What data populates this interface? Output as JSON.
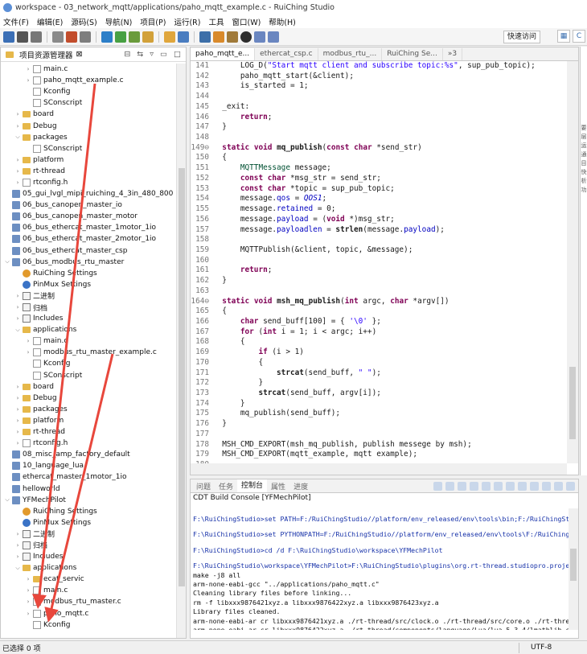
{
  "window": {
    "title": "workspace - 03_network_mqtt/applications/paho_mqtt_example.c - RuiChing Studio"
  },
  "menu": [
    "文件(F)",
    "编辑(E)",
    "源码(S)",
    "导航(N)",
    "项目(P)",
    "运行(R)",
    "工具",
    "窗口(W)",
    "帮助(H)"
  ],
  "toolbar": {
    "quick_access": "快速访问"
  },
  "explorer": {
    "title": "项目资源管理器",
    "tab_suffix": "⊠",
    "rows": [
      {
        "t": "main.c",
        "i": "file",
        "a": ">",
        "d": 2
      },
      {
        "t": "paho_mqtt_example.c",
        "i": "file",
        "a": ">",
        "d": 2
      },
      {
        "t": "Kconfig",
        "i": "file",
        "a": "",
        "d": 2
      },
      {
        "t": "SConscript",
        "i": "file",
        "a": "",
        "d": 2
      },
      {
        "t": "board",
        "i": "folder",
        "a": ">",
        "d": 1
      },
      {
        "t": "Debug",
        "i": "folder",
        "a": ">",
        "d": 1
      },
      {
        "t": "packages",
        "i": "folder",
        "a": "v",
        "d": 1
      },
      {
        "t": "SConscript",
        "i": "file",
        "a": "",
        "d": 2
      },
      {
        "t": "platform",
        "i": "folder",
        "a": ">",
        "d": 1
      },
      {
        "t": "rt-thread",
        "i": "folder",
        "a": ">",
        "d": 1
      },
      {
        "t": "rtconfig.h",
        "i": "file",
        "a": ">",
        "d": 1
      },
      {
        "t": "05_gui_lvgl_mipi_ruiching_4_3in_480_800",
        "i": "proj",
        "a": "",
        "d": 0
      },
      {
        "t": "06_bus_canopen_master_io",
        "i": "proj",
        "a": "",
        "d": 0
      },
      {
        "t": "06_bus_canopen_master_motor",
        "i": "proj",
        "a": "",
        "d": 0
      },
      {
        "t": "06_bus_ethercat_master_1motor_1io",
        "i": "proj",
        "a": "",
        "d": 0
      },
      {
        "t": "06_bus_ethercat_master_2motor_1io",
        "i": "proj",
        "a": "",
        "d": 0
      },
      {
        "t": "06_bus_ethercat_master_csp",
        "i": "proj",
        "a": "",
        "d": 0
      },
      {
        "t": "06_bus_modbus_rtu_master",
        "i": "proj",
        "a": "v",
        "d": 0
      },
      {
        "t": "RuiChing Settings",
        "i": "gear",
        "a": "",
        "d": 1
      },
      {
        "t": "PinMux Settings",
        "i": "pin",
        "a": "",
        "d": 1
      },
      {
        "t": "二进制",
        "i": "lib",
        "a": ">",
        "d": 1
      },
      {
        "t": "归档",
        "i": "lib",
        "a": ">",
        "d": 1
      },
      {
        "t": "Includes",
        "i": "lib",
        "a": ">",
        "d": 1
      },
      {
        "t": "applications",
        "i": "folder",
        "a": "v",
        "d": 1
      },
      {
        "t": "main.c",
        "i": "file",
        "a": ">",
        "d": 2
      },
      {
        "t": "modbus_rtu_master_example.c",
        "i": "file",
        "a": ">",
        "d": 2
      },
      {
        "t": "Kconfig",
        "i": "file",
        "a": "",
        "d": 2
      },
      {
        "t": "SConscript",
        "i": "file",
        "a": "",
        "d": 2
      },
      {
        "t": "board",
        "i": "folder",
        "a": ">",
        "d": 1
      },
      {
        "t": "Debug",
        "i": "folder",
        "a": ">",
        "d": 1
      },
      {
        "t": "packages",
        "i": "folder",
        "a": ">",
        "d": 1
      },
      {
        "t": "platform",
        "i": "folder",
        "a": ">",
        "d": 1
      },
      {
        "t": "rt-thread",
        "i": "folder",
        "a": ">",
        "d": 1
      },
      {
        "t": "rtconfig.h",
        "i": "file",
        "a": ">",
        "d": 1
      },
      {
        "t": "08_misc_amp_factory_default",
        "i": "proj",
        "a": "",
        "d": 0
      },
      {
        "t": "10_language_lua",
        "i": "proj",
        "a": "",
        "d": 0
      },
      {
        "t": "ethercat_master_1motor_1io",
        "i": "proj",
        "a": "",
        "d": 0
      },
      {
        "t": "helloworld",
        "i": "proj",
        "a": "",
        "d": 0
      },
      {
        "t": "YFMechPilot",
        "i": "proj",
        "a": "v",
        "d": 0
      },
      {
        "t": "RuiChing Settings",
        "i": "gear",
        "a": "",
        "d": 1
      },
      {
        "t": "PinMux Settings",
        "i": "pin",
        "a": "",
        "d": 1
      },
      {
        "t": "二进制",
        "i": "lib",
        "a": ">",
        "d": 1
      },
      {
        "t": "归档",
        "i": "lib",
        "a": ">",
        "d": 1
      },
      {
        "t": "Includes",
        "i": "lib",
        "a": ">",
        "d": 1
      },
      {
        "t": "applications",
        "i": "folder",
        "a": "v",
        "d": 1
      },
      {
        "t": "ecat_servic",
        "i": "folder",
        "a": ">",
        "d": 2
      },
      {
        "t": "main.c",
        "i": "file",
        "a": ">",
        "d": 2
      },
      {
        "t": "modbus_rtu_master.c",
        "i": "file",
        "a": ">",
        "d": 2
      },
      {
        "t": "paho_mqtt.c",
        "i": "file",
        "a": ">",
        "d": 2
      },
      {
        "t": "Kconfig",
        "i": "file",
        "a": "",
        "d": 2
      }
    ]
  },
  "editor": {
    "tabs": [
      "paho_mqtt_e...",
      "ethercat_csp.c",
      "modbus_rtu_...",
      "RuiChing Se...",
      "»3"
    ],
    "lines": [
      {
        "n": "141",
        "h": "      <span class=\"ct\">LOG_D(</span><span class=\"str\">\"Start mqtt client and subscribe topic:%s\"</span>, sup_pub_topic);"
      },
      {
        "n": "142",
        "h": "      paho_mqtt_start(&amp;client);"
      },
      {
        "n": "143",
        "h": "      is_started = 1;"
      },
      {
        "n": "144",
        "h": ""
      },
      {
        "n": "145",
        "h": "  _exit:"
      },
      {
        "n": "146",
        "h": "      <span class=\"kw\">return</span>;"
      },
      {
        "n": "147",
        "h": "  }"
      },
      {
        "n": "148",
        "h": ""
      },
      {
        "n": "149⊖",
        "h": "  <span class=\"kw\">static</span> <span class=\"kw\">void</span> <b>mq_publish</b>(<span class=\"kw\">const</span> <span class=\"kw\">char</span> *send_str)"
      },
      {
        "n": "150",
        "h": "  {"
      },
      {
        "n": "151",
        "h": "      <span class=\"typ\">MQTTMessage</span> message;"
      },
      {
        "n": "152",
        "h": "      <span class=\"kw\">const</span> <span class=\"kw\">char</span> *msg_str = send_str;"
      },
      {
        "n": "153",
        "h": "      <span class=\"kw\">const</span> <span class=\"kw\">char</span> *topic = sup_pub_topic;"
      },
      {
        "n": "154",
        "h": "      message.<span class=\"fld\">qos</span> = <span class=\"mac\">QOS1</span>;"
      },
      {
        "n": "155",
        "h": "      message.<span class=\"fld\">retained</span> = 0;"
      },
      {
        "n": "156",
        "h": "      message.<span class=\"fld\">payload</span> = (<span class=\"kw\">void</span> *)msg_str;"
      },
      {
        "n": "157",
        "h": "      message.<span class=\"fld\">payloadlen</span> = <b>strlen</b>(message.<span class=\"fld\">payload</span>);"
      },
      {
        "n": "158",
        "h": ""
      },
      {
        "n": "159",
        "h": "      MQTTPublish(&amp;client, topic, &amp;message);"
      },
      {
        "n": "160",
        "h": ""
      },
      {
        "n": "161",
        "h": "      <span class=\"kw\">return</span>;"
      },
      {
        "n": "162",
        "h": "  }"
      },
      {
        "n": "163",
        "h": ""
      },
      {
        "n": "164⊖",
        "h": "  <span class=\"kw\">static</span> <span class=\"kw\">void</span> <b>msh_mq_publish</b>(<span class=\"kw\">int</span> argc, <span class=\"kw\">char</span> *argv[])"
      },
      {
        "n": "165",
        "h": "  {"
      },
      {
        "n": "166",
        "h": "      <span class=\"kw\">char</span> send_buff[100] = { <span class=\"str\">'\\0'</span> };"
      },
      {
        "n": "167",
        "h": "      <span class=\"kw\">for</span> (<span class=\"kw\">int</span> i = 1; i &lt; argc; i++)"
      },
      {
        "n": "168",
        "h": "      {"
      },
      {
        "n": "169",
        "h": "          <span class=\"kw\">if</span> (i &gt; 1)"
      },
      {
        "n": "170",
        "h": "          {"
      },
      {
        "n": "171",
        "h": "              <b>strcat</b>(send_buff, <span class=\"str\">\" \"</span>);"
      },
      {
        "n": "172",
        "h": "          }"
      },
      {
        "n": "173",
        "h": "          <b>strcat</b>(send_buff, argv[i]);"
      },
      {
        "n": "174",
        "h": "      }"
      },
      {
        "n": "175",
        "h": "      mq_publish(send_buff);"
      },
      {
        "n": "176",
        "h": "  }"
      },
      {
        "n": "177",
        "h": ""
      },
      {
        "n": "178",
        "h": "  MSH_CMD_EXPORT(msh_mq_publish, publish messege by msh);"
      },
      {
        "n": "179",
        "h": "  MSH_CMD_EXPORT(mqtt_example, mqtt example);"
      },
      {
        "n": "180",
        "h": ""
      }
    ]
  },
  "console": {
    "tabs": [
      "问题",
      "任务",
      "控制台",
      "属性",
      "进度"
    ],
    "active_tab": "控制台",
    "title": "CDT Build Console [YFMechPilot]",
    "lines": [
      {
        "t": "",
        "c": "sp"
      },
      {
        "t": "F:\\RuiChingStudio>set PATH=F:/RuiChingStudio//platform/env_released/env\\tools\\bin;F:/RuiChingSt",
        "c": "blue"
      },
      {
        "t": "",
        "c": "sp"
      },
      {
        "t": "F:\\RuiChingStudio>set PYTHONPATH=F:/RuiChingStudio//platform/env_released/env\\tools\\F:/RuiChing",
        "c": "blue"
      },
      {
        "t": "",
        "c": "sp"
      },
      {
        "t": "F:\\RuiChingStudio>cd /d F:\\RuiChingStudio\\workspace\\YFMechPilot",
        "c": "blue"
      },
      {
        "t": "",
        "c": "sp"
      },
      {
        "t": "F:\\RuiChingStudio\\workspace\\YFMechPilot>F:\\RuiChingStudio\\plugins\\org.rt-thread.studiopro.proje",
        "c": "blue"
      },
      {
        "t": "make -j8 all",
        "c": ""
      },
      {
        "t": "arm-none-eabi-gcc \"../applications/paho_mqtt.c\"",
        "c": ""
      },
      {
        "t": "Cleaning library files before linking...",
        "c": ""
      },
      {
        "t": "rm -f libxxx9876421xyz.a libxxx9876422xyz.a libxxx9876423xyz.a",
        "c": ""
      },
      {
        "t": "Library files cleaned.",
        "c": ""
      },
      {
        "t": "arm-none-eabi-ar cr libxxx9876421xyz.a ./rt-thread/src/clock.o ./rt-thread/src/core.o ./rt-thre",
        "c": ""
      },
      {
        "t": "arm-none-eabi-ar cr libxxx9876422xyz.a ./rt-thread/components/language/Lua/lua-5.3.4/lmathlib.c",
        "c": ""
      }
    ]
  },
  "outline_strip": [
    "要",
    "层",
    "运",
    "通",
    "目",
    "快",
    "析",
    "功"
  ],
  "status": {
    "left": "已选择 0 项",
    "encoding": "UTF-8"
  },
  "colors": {
    "keyword": "#7f0055",
    "string": "#2a00ff",
    "console_cmd": "#1530a8",
    "annotation_arrow": "#e8473c"
  }
}
